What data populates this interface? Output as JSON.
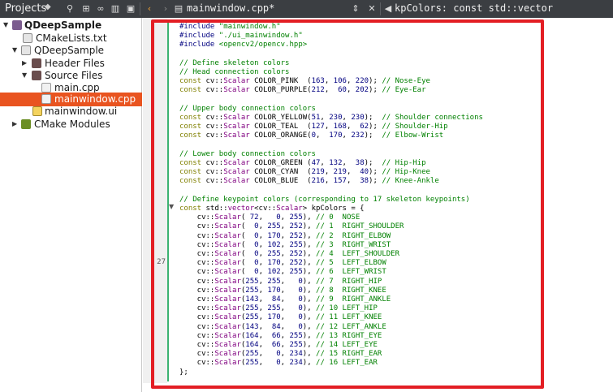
{
  "topbar": {
    "panel_title": "Projects",
    "editor_tab": "mainwindow.cpp*",
    "symbol_tab": "kpColors: const std::vector"
  },
  "sidebar": {
    "items": [
      {
        "label": "QDeepSample"
      },
      {
        "label": "CMakeLists.txt"
      },
      {
        "label": "QDeepSample"
      },
      {
        "label": "Header Files"
      },
      {
        "label": "Source Files"
      },
      {
        "label": "main.cpp"
      },
      {
        "label": "mainwindow.cpp"
      },
      {
        "label": "mainwindow.ui"
      },
      {
        "label": "CMake Modules"
      }
    ]
  },
  "editor": {
    "current_line_number": "27",
    "lines": [
      "#include \"mainwindow.h\"",
      "#include \"./ui_mainwindow.h\"",
      "#include <opencv2/opencv.hpp>",
      "",
      "// Define skeleton colors",
      "// Head connection colors",
      "const cv::Scalar COLOR_PINK  (163, 106, 220); // Nose-Eye",
      "const cv::Scalar COLOR_PURPLE(212,  60, 202); // Eye-Ear",
      "",
      "// Upper body connection colors",
      "const cv::Scalar COLOR_YELLOW(51, 230, 230);  // Shoulder connections",
      "const cv::Scalar COLOR_TEAL  (127, 168,  62); // Shoulder-Hip",
      "const cv::Scalar COLOR_ORANGE(0,  170, 232);  // Elbow-Wrist",
      "",
      "// Lower body connection colors",
      "const cv::Scalar COLOR_GREEN (47, 132,  38);  // Hip-Hip",
      "const cv::Scalar COLOR_CYAN  (219, 219,  40); // Hip-Knee",
      "const cv::Scalar COLOR_BLUE  (216, 157,  38); // Knee-Ankle",
      "",
      "// Define keypoint colors (corresponding to 17 skeleton keypoints)",
      "const std::vector<cv::Scalar> kpColors = {",
      "    cv::Scalar( 72,   0, 255), // 0  NOSE",
      "    cv::Scalar(  0, 255, 252), // 1  RIGHT_SHOULDER",
      "    cv::Scalar(  0, 170, 252), // 2  RIGHT_ELBOW",
      "    cv::Scalar(  0, 102, 255), // 3  RIGHT_WRIST",
      "    cv::Scalar(  0, 255, 252), // 4  LEFT_SHOULDER",
      "    cv::Scalar(  0, 170, 252), // 5  LEFT_ELBOW",
      "    cv::Scalar(  0, 102, 255), // 6  LEFT_WRIST",
      "    cv::Scalar(255, 255,   0), // 7  RIGHT_HIP",
      "    cv::Scalar(255, 170,   0), // 8  RIGHT_KNEE",
      "    cv::Scalar(143,  84,   0), // 9  RIGHT_ANKLE",
      "    cv::Scalar(255, 255,   0), // 10 LEFT_HIP",
      "    cv::Scalar(255, 170,   0), // 11 LEFT_KNEE",
      "    cv::Scalar(143,  84,   0), // 12 LEFT_ANKLE",
      "    cv::Scalar(164,  66, 255), // 13 RIGHT_EYE",
      "    cv::Scalar(164,  66, 255), // 14 LEFT_EYE",
      "    cv::Scalar(255,   0, 234), // 15 RIGHT_EAR",
      "    cv::Scalar(255,   0, 234), // 16 LEFT_EAR",
      "};"
    ]
  },
  "colors": {
    "selection": "#e95420",
    "highlight_box": "#e31e24",
    "change_bar": "#3cb371"
  }
}
